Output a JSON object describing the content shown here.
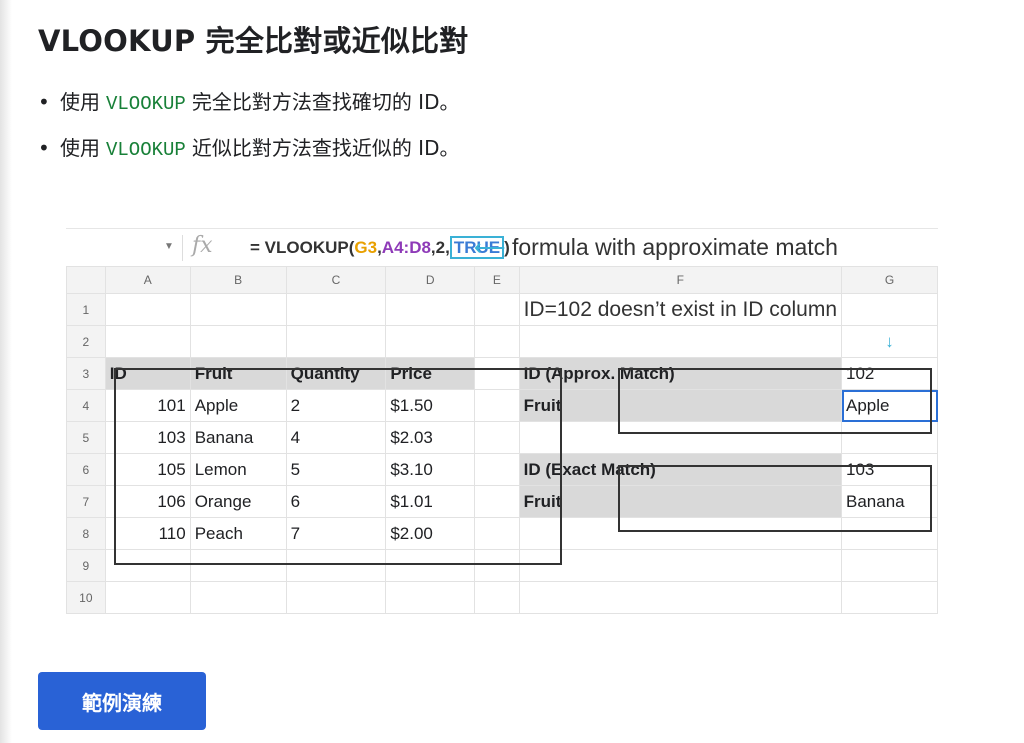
{
  "title": "VLOOKUP 完全比對或近似比對",
  "bullets": [
    {
      "prefix": "使用",
      "code": "VLOOKUP",
      "suffix": "完全比對方法查找確切的 ID。"
    },
    {
      "prefix": "使用",
      "code": "VLOOKUP",
      "suffix": "近似比對方法查找近似的 ID。"
    }
  ],
  "formula_bar": {
    "fx": "fx",
    "formula_start": "= VLOOKUP(",
    "ref1": "G3",
    "comma1": ",",
    "ref2": "A4:D8",
    "comma2": ",2,",
    "ref3": "TRUE",
    "close": ")",
    "arrow": "⟵",
    "note": "formula with approximate match"
  },
  "sheet": {
    "columns": [
      "A",
      "B",
      "C",
      "D",
      "E",
      "F",
      "G"
    ],
    "row_numbers": [
      "1",
      "2",
      "3",
      "4",
      "5",
      "6",
      "7",
      "8",
      "9",
      "10"
    ],
    "note": "ID=102 doesn’t exist in ID column",
    "down_arrow": "↓",
    "table_headers": [
      "ID",
      "Fruit",
      "Quantity",
      "Price"
    ],
    "table_rows": [
      [
        "101",
        "Apple",
        "2",
        "$1.50"
      ],
      [
        "103",
        "Banana",
        "4",
        "$2.03"
      ],
      [
        "105",
        "Lemon",
        "5",
        "$3.10"
      ],
      [
        "106",
        "Orange",
        "6",
        "$1.01"
      ],
      [
        "110",
        "Peach",
        "7",
        "$2.00"
      ]
    ],
    "approx": {
      "label1": "ID (Approx. Match)",
      "value1": "102",
      "label2": "Fruit",
      "value2": "Apple"
    },
    "exact": {
      "label1": "ID (Exact Match)",
      "value1": "103",
      "label2": "Fruit",
      "value2": "Banana"
    }
  },
  "button_label": "範例演練"
}
